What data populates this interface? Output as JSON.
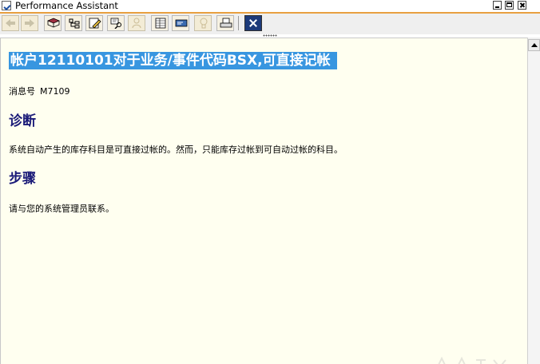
{
  "window": {
    "title": "Performance Assistant"
  },
  "toolbar": {
    "buttons": [
      {
        "icon": "back-arrow-icon",
        "enabled": false
      },
      {
        "icon": "forward-arrow-icon",
        "enabled": false
      },
      {
        "icon": "book-icon",
        "enabled": true
      },
      {
        "icon": "technical-info-icon",
        "enabled": true
      },
      {
        "icon": "edit-pencil-icon",
        "enabled": true
      },
      {
        "icon": "search-documentation-icon",
        "enabled": true
      },
      {
        "icon": "user-icon",
        "enabled": false
      },
      {
        "icon": "table-icon",
        "enabled": true
      },
      {
        "icon": "display-options-icon",
        "enabled": true
      },
      {
        "icon": "lightbulb-icon",
        "enabled": false
      },
      {
        "icon": "print-icon",
        "enabled": true
      },
      {
        "icon": "close-icon",
        "enabled": true
      }
    ]
  },
  "message": {
    "title": "帐户12110101对于业务/事件代码BSX,可直接记帐",
    "number_label": "消息号",
    "number": "M7109"
  },
  "sections": {
    "diagnosis": {
      "heading": "诊断",
      "text": "系统自动产生的库存科目是可直接过帐的。然而，只能库存过帐到可自动过帐的科目。"
    },
    "procedure": {
      "heading": "步骤",
      "text": "请与您的系统管理员联系。"
    }
  },
  "colors": {
    "title_highlight": "#3896e0",
    "heading": "#1a1a78",
    "content_bg": "#fffff0",
    "accent_line": "#e8a040"
  }
}
